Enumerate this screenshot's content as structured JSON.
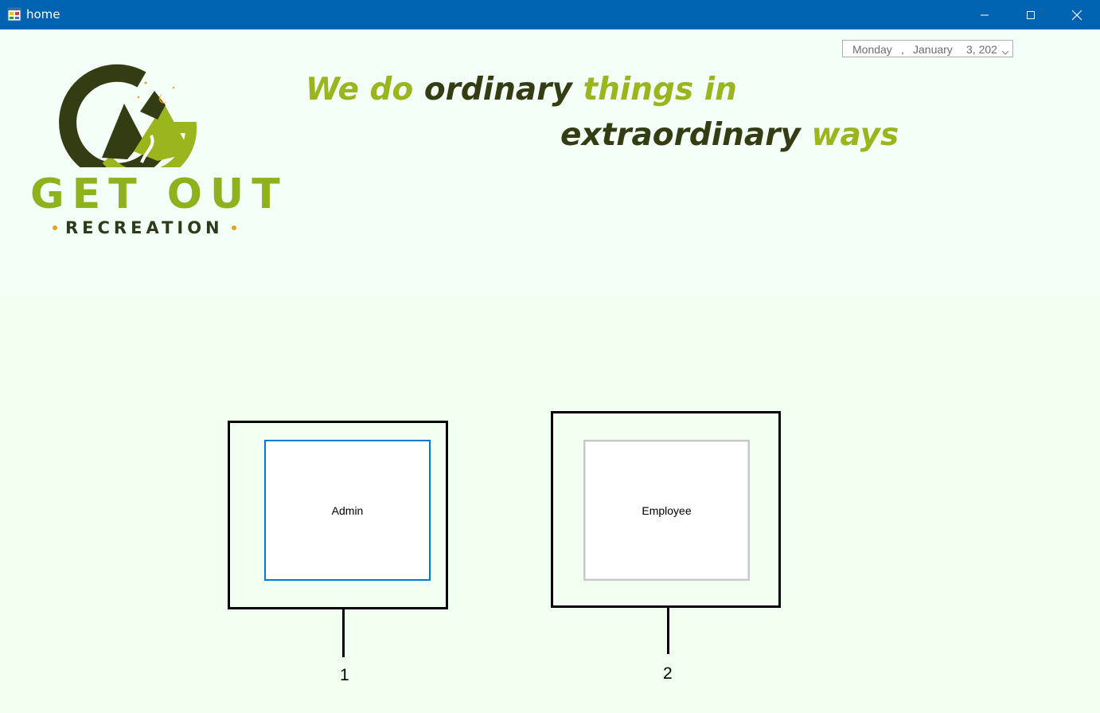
{
  "window": {
    "title": "home",
    "icon": "app-form-icon",
    "controls": [
      "minimize-icon",
      "maximize-icon",
      "close-icon"
    ],
    "titlebar_color": "#0063b1"
  },
  "date_picker": {
    "day": "Monday",
    "separator": ",",
    "month": "January",
    "rest": "3, 202",
    "dropdown_icon": "chevron-down-icon"
  },
  "logo": {
    "line1": "GET OUT",
    "line2": "RECREATION"
  },
  "tagline": {
    "part1": "We do",
    "part2": "ordinary",
    "part3": "things in",
    "part4": "extraordinary",
    "part5": "ways"
  },
  "buttons": {
    "admin_label": "Admin",
    "employee_label": "Employee"
  },
  "annotations": {
    "callout_1": "1",
    "callout_2": "2"
  },
  "colors": {
    "background": "#f0fff0",
    "brand_green": "#9ab51d",
    "brand_dark": "#343c14",
    "accent_orange": "#e8a020",
    "focus_blue": "#0078d7"
  }
}
